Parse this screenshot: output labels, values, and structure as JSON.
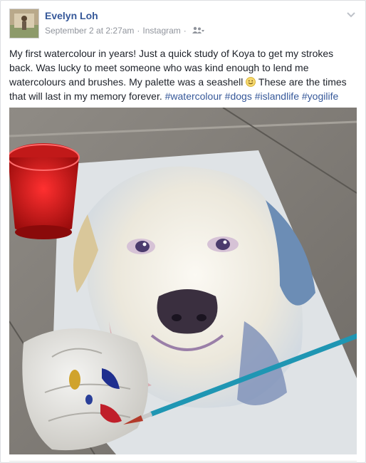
{
  "post": {
    "author": "Evelyn Loh",
    "date": "September 2 at 2:27am",
    "separator": "·",
    "source": "Instagram",
    "audience_icon": "friends-icon",
    "menu_icon": "chevron-down-icon",
    "text_part1": "My first watercolour in years! Just a quick study of Koya to get my strokes back. Was lucky to meet someone who was kind enough to lend me watercolours and brushes. My palette was a seashell",
    "text_part2": " These are the times that will last in my memory forever. ",
    "hashtags": [
      "#watercolour",
      "#dogs",
      "#islandlife",
      "#yogilife"
    ],
    "emoji": "smile-emoji"
  },
  "colors": {
    "link": "#365899",
    "meta": "#90949c",
    "text": "#1d2129"
  }
}
